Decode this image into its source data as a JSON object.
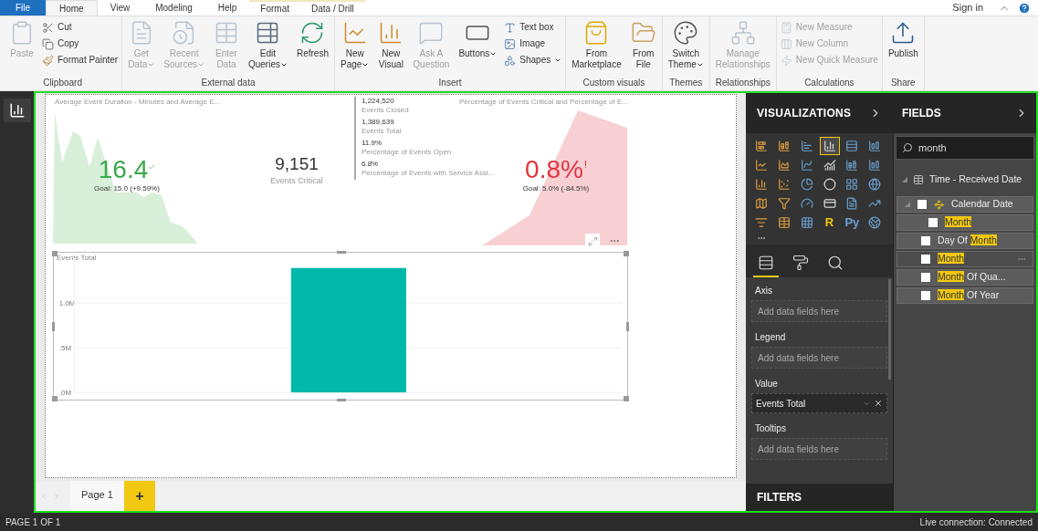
{
  "tabs": [
    {
      "label": "File",
      "kind": "file",
      "selected": false
    },
    {
      "label": "Home",
      "kind": "tab",
      "selected": true
    },
    {
      "label": "View",
      "kind": "tab",
      "selected": false
    },
    {
      "label": "Modeling",
      "kind": "tab",
      "selected": false
    },
    {
      "label": "Help",
      "kind": "tab",
      "selected": false
    },
    {
      "label": "Format",
      "kind": "context",
      "selected": false
    },
    {
      "label": "Data / Drill",
      "kind": "context",
      "selected": false
    }
  ],
  "sign_in": "Sign in",
  "ribbon_groups": [
    {
      "label": "Clipboard",
      "items": [
        {
          "kind": "large",
          "label": "Paste",
          "disabled": true,
          "dropdown": false
        },
        {
          "kind": "stack",
          "buttons": [
            {
              "label": "Cut",
              "disabled": false,
              "dropdown": false
            },
            {
              "label": "Copy",
              "disabled": false,
              "dropdown": false
            },
            {
              "label": "Format Painter",
              "disabled": false,
              "dropdown": false
            }
          ]
        }
      ]
    },
    {
      "label": "External data",
      "items": [
        {
          "kind": "large",
          "label": "Get\nData",
          "disabled": true,
          "dropdown": true
        },
        {
          "kind": "large",
          "label": "Recent\nSources",
          "disabled": true,
          "dropdown": true
        },
        {
          "kind": "large",
          "label": "Enter\nData",
          "disabled": true,
          "dropdown": false
        },
        {
          "kind": "large",
          "label": "Edit\nQueries",
          "disabled": false,
          "dropdown": true
        },
        {
          "kind": "large",
          "label": "Refresh",
          "disabled": false,
          "dropdown": false
        }
      ]
    },
    {
      "label": "Insert",
      "items": [
        {
          "kind": "large",
          "label": "New\nPage",
          "disabled": false,
          "dropdown": true
        },
        {
          "kind": "large",
          "label": "New\nVisual",
          "disabled": false,
          "dropdown": false
        },
        {
          "kind": "large",
          "label": "Ask A\nQuestion",
          "disabled": true,
          "dropdown": false
        },
        {
          "kind": "large",
          "label": "Buttons",
          "disabled": false,
          "dropdown": true
        },
        {
          "kind": "stack",
          "buttons": [
            {
              "label": "Text box",
              "disabled": false,
              "dropdown": false
            },
            {
              "label": "Image",
              "disabled": false,
              "dropdown": false
            },
            {
              "label": "Shapes",
              "disabled": false,
              "dropdown": true
            }
          ]
        }
      ]
    },
    {
      "label": "Custom visuals",
      "items": [
        {
          "kind": "large",
          "label": "From\nMarketplace",
          "disabled": false,
          "dropdown": false
        },
        {
          "kind": "large",
          "label": "From\nFile",
          "disabled": false,
          "dropdown": false
        }
      ]
    },
    {
      "label": "Themes",
      "items": [
        {
          "kind": "large",
          "label": "Switch\nTheme",
          "disabled": false,
          "dropdown": true
        }
      ]
    },
    {
      "label": "Relationships",
      "items": [
        {
          "kind": "large",
          "label": "Manage\nRelationships",
          "disabled": true,
          "dropdown": false
        }
      ]
    },
    {
      "label": "Calculations",
      "items": [
        {
          "kind": "stack",
          "buttons": [
            {
              "label": "New Measure",
              "disabled": true,
              "dropdown": false
            },
            {
              "label": "New Column",
              "disabled": true,
              "dropdown": false
            },
            {
              "label": "New Quick Measure",
              "disabled": true,
              "dropdown": false
            }
          ]
        }
      ]
    },
    {
      "label": "Share",
      "items": [
        {
          "kind": "large",
          "label": "Publish",
          "disabled": false,
          "dropdown": false
        }
      ]
    }
  ],
  "rail": [
    {
      "kind": "report",
      "selected": true
    }
  ],
  "report": {
    "kpis": [
      {
        "title": "Average Event Duration - Minutes and Average E...",
        "value": "16.4",
        "goal": "Goal: 15.0 (+9.59%)",
        "on_target": true
      },
      {
        "title": "Percentage of Events Critical and Percentage of E...",
        "value": "0.8%",
        "goal": "Goal: 5.0% (-84.5%)",
        "on_target": false
      }
    ],
    "card": {
      "value": "9,151",
      "label": "Events Critical"
    },
    "multi_row_card": [
      {
        "value": "1,224,520",
        "label": "Events Closed"
      },
      {
        "value": "1,389,639",
        "label": "Events Total"
      },
      {
        "value": "11.9%",
        "label": "Percentage of Events Open"
      },
      {
        "value": "6.8%",
        "label": "Percentage of Events with Service Assi..."
      }
    ],
    "bar_chart": {
      "selected": true,
      "chart_data": {
        "type": "bar",
        "title": "Events Total",
        "values": [
          1390000
        ],
        "ylim": [
          0,
          1500000
        ],
        "yticks": [
          {
            "value": 0,
            "label": ".0M"
          },
          {
            "value": 500000,
            "label": ".5M"
          },
          {
            "value": 1000000,
            "label": "1.0M"
          }
        ]
      }
    }
  },
  "pages": [
    {
      "label": "Page 1",
      "selected": true
    }
  ],
  "add_page": "+",
  "visualizations": {
    "title": "VISUALIZATIONS",
    "visuals": [
      {
        "kind": "icon",
        "selected": false
      },
      {
        "kind": "icon",
        "selected": false
      },
      {
        "kind": "icon",
        "selected": false
      },
      {
        "kind": "icon",
        "selected": true
      },
      {
        "kind": "icon",
        "selected": false
      },
      {
        "kind": "icon",
        "selected": false
      },
      {
        "kind": "icon",
        "selected": false
      },
      {
        "kind": "icon",
        "selected": false
      },
      {
        "kind": "icon",
        "selected": false
      },
      {
        "kind": "icon",
        "selected": false
      },
      {
        "kind": "icon",
        "selected": false
      },
      {
        "kind": "icon",
        "selected": false
      },
      {
        "kind": "icon",
        "selected": false
      },
      {
        "kind": "icon",
        "selected": false
      },
      {
        "kind": "icon",
        "selected": false
      },
      {
        "kind": "icon",
        "selected": false
      },
      {
        "kind": "icon",
        "selected": false
      },
      {
        "kind": "icon",
        "selected": false
      },
      {
        "kind": "icon",
        "selected": false
      },
      {
        "kind": "icon",
        "selected": false
      },
      {
        "kind": "icon",
        "selected": false
      },
      {
        "kind": "icon",
        "selected": false
      },
      {
        "kind": "icon",
        "selected": false
      },
      {
        "kind": "icon",
        "selected": false
      },
      {
        "kind": "icon",
        "selected": false
      },
      {
        "kind": "icon",
        "selected": false
      },
      {
        "kind": "icon",
        "selected": false
      },
      {
        "kind": "text",
        "label": "R",
        "selected": false
      },
      {
        "kind": "text",
        "label": "Py",
        "selected": false
      },
      {
        "kind": "icon",
        "selected": false
      }
    ],
    "pane_tabs": [
      {
        "kind": "fields",
        "selected": true
      },
      {
        "kind": "format",
        "selected": false
      },
      {
        "kind": "analytics",
        "selected": false
      }
    ],
    "wells": [
      {
        "label": "Axis",
        "placeholder": "Add data fields here"
      },
      {
        "label": "Legend",
        "placeholder": "Add data fields here"
      },
      {
        "label": "Value",
        "fields": [
          "Events Total"
        ]
      },
      {
        "label": "Tooltips",
        "placeholder": "Add data fields here"
      }
    ]
  },
  "filters": {
    "title": "FILTERS"
  },
  "fields": {
    "title": "FIELDS",
    "search": {
      "value": "month"
    },
    "tables": [
      {
        "name": "Time - Received Date",
        "expanded": true,
        "children": [
          {
            "kind": "hierarchy",
            "expanded": true,
            "checked": false,
            "hovered": false,
            "parts": [
              {
                "text": "Calendar Date",
                "highlighted": false
              }
            ],
            "children": [
              {
                "kind": "field",
                "checked": false,
                "hovered": false,
                "parts": [
                  {
                    "text": "Month",
                    "highlighted": true
                  }
                ]
              }
            ]
          },
          {
            "kind": "field",
            "checked": false,
            "hovered": false,
            "parts": [
              {
                "text": "Day Of ",
                "highlighted": false
              },
              {
                "text": "Month",
                "highlighted": true
              }
            ]
          },
          {
            "kind": "field",
            "checked": false,
            "hovered": true,
            "parts": [
              {
                "text": "Month",
                "highlighted": true
              }
            ]
          },
          {
            "kind": "field",
            "checked": false,
            "hovered": false,
            "parts": [
              {
                "text": "Month",
                "highlighted": true
              },
              {
                "text": " Of Qua...",
                "highlighted": false
              }
            ]
          },
          {
            "kind": "field",
            "checked": false,
            "hovered": false,
            "parts": [
              {
                "text": "Month",
                "highlighted": true
              },
              {
                "text": " Of Year",
                "highlighted": false
              }
            ]
          }
        ]
      }
    ]
  },
  "status_bar": {
    "page": "PAGE 1 OF 1",
    "connection": "Live connection: Connected"
  }
}
